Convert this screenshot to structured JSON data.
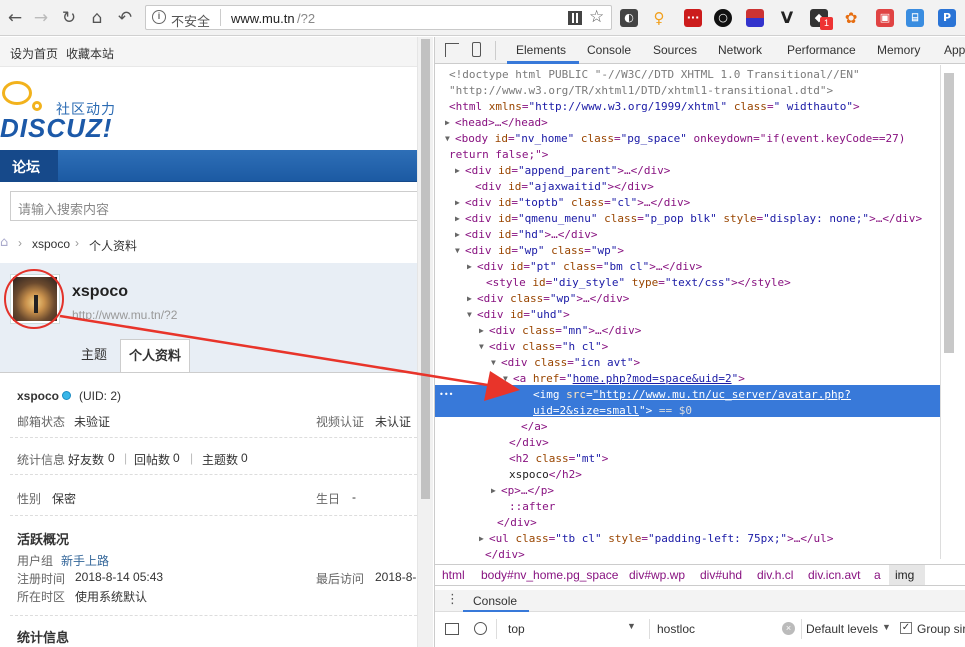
{
  "browser": {
    "security_label": "不安全",
    "url_host": "www.mu.tn",
    "url_path": "/?2",
    "extension_badge": "1"
  },
  "page": {
    "top_links": [
      "设为首页",
      "收藏本站"
    ],
    "logo_text": "DISCUZ!",
    "logo_sub": "社区动力",
    "nav_item": "论坛",
    "search_placeholder": "请输入搜索内容",
    "breadcrumb": {
      "user": "xspoco",
      "current": "个人资料"
    },
    "profile": {
      "username": "xspoco",
      "url": "http://www.mu.tn/?2",
      "tabs": [
        "主题",
        "个人资料"
      ],
      "uid_name": "xspoco",
      "uid": "(UID: 2)",
      "email_label": "邮箱状态",
      "email_value": "未验证",
      "video_label": "视频认证",
      "video_value": "未认证",
      "stats_label": "统计信息",
      "friends_label": "好友数",
      "friends_value": "0",
      "replies_label": "回帖数",
      "replies_value": "0",
      "threads_label": "主题数",
      "threads_value": "0",
      "gender_label": "性别",
      "gender_value": "保密",
      "birthday_label": "生日",
      "birthday_value": "-",
      "activity_title": "活跃概况",
      "group_label": "用户组",
      "group_value": "新手上路",
      "reg_label": "注册时间",
      "reg_value": "2018-8-14 05:43",
      "last_label": "最后访问",
      "last_value": "2018-8-",
      "tz_label": "所在时区",
      "tz_value": "使用系统默认",
      "stats_title": "统计信息"
    }
  },
  "devtools": {
    "tabs": [
      "Elements",
      "Console",
      "Sources",
      "Network",
      "Performance",
      "Memory",
      "App"
    ],
    "active_tab": "Elements",
    "crumbs": [
      "html",
      "body#nv_home.pg_space",
      "div#wp.wp",
      "div#uhd",
      "div.h.cl",
      "div.icn.avt",
      "a",
      "img"
    ],
    "drawer_tab": "Console",
    "console_context": "top",
    "console_filter": "hostloc",
    "console_levels": "Default levels",
    "console_group": "Group sir",
    "selected_marker": "== $0"
  },
  "colors": {
    "nav_blue": "#1c5aa3",
    "link_blue": "#336699",
    "selection": "#3879d9",
    "annotation_red": "#e8342a"
  }
}
